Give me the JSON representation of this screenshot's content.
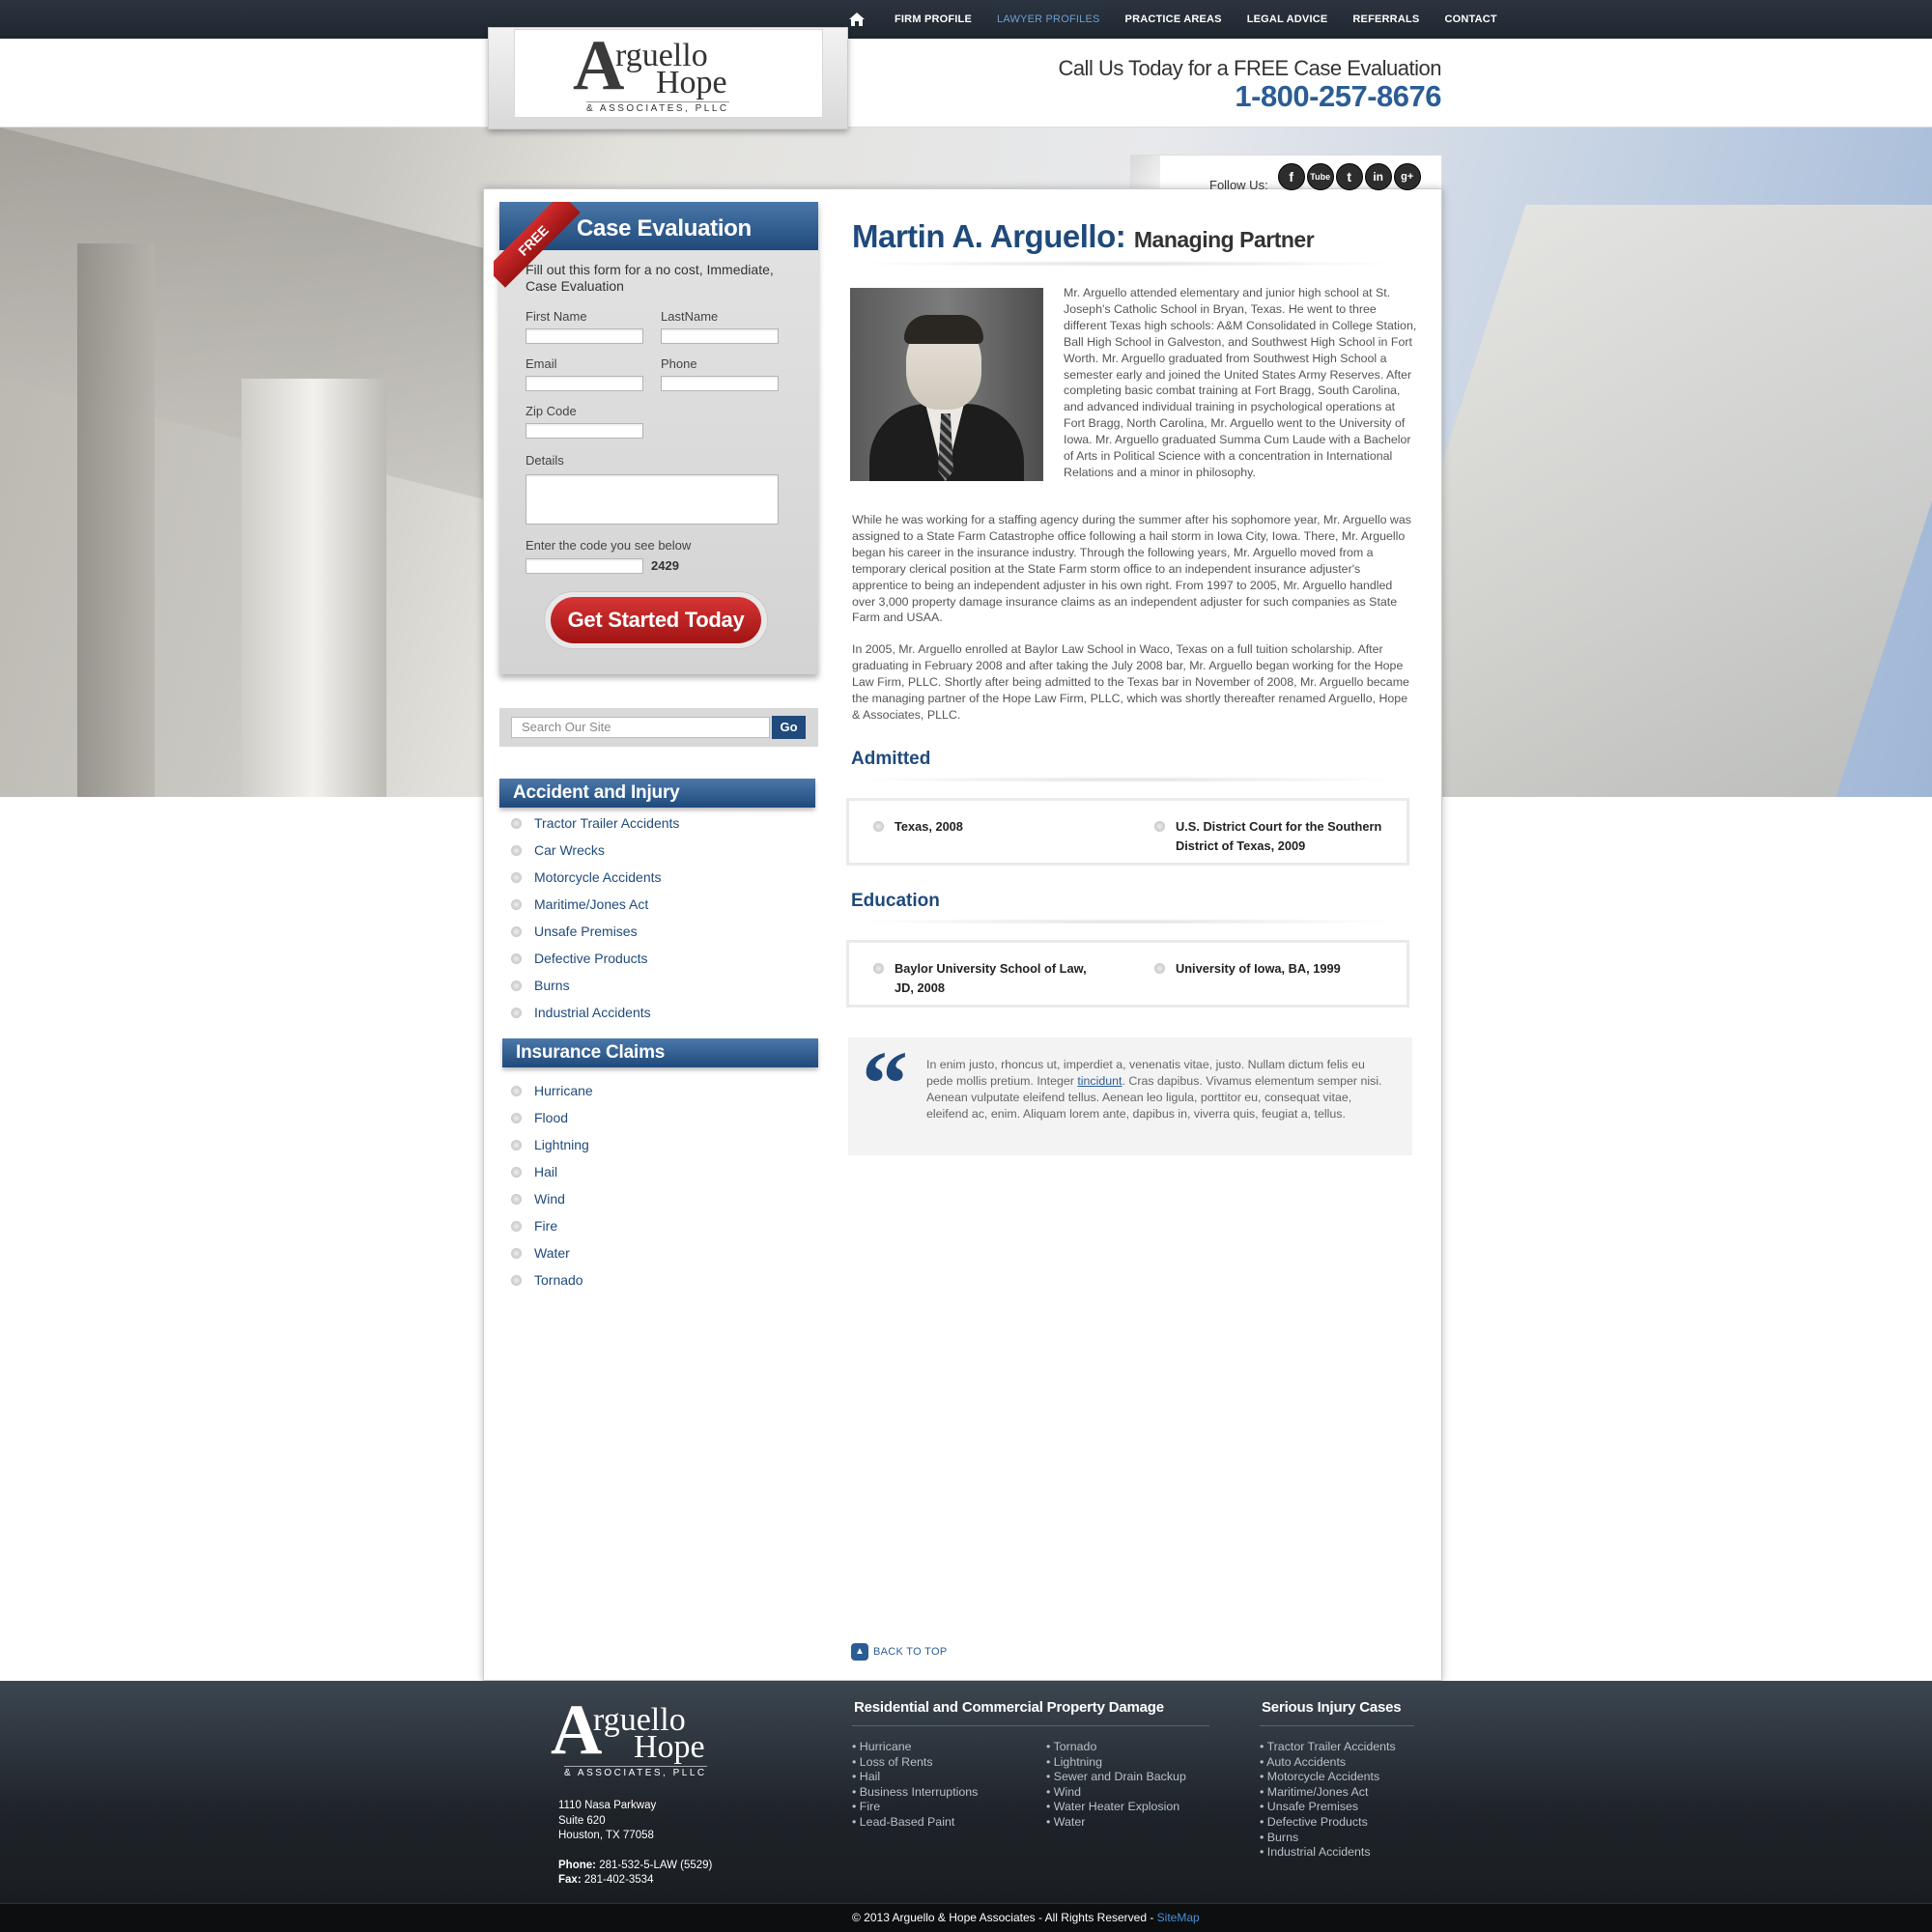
{
  "nav": {
    "items": [
      "FIRM PROFILE",
      "LAWYER PROFILES",
      "PRACTICE AREAS",
      "LEGAL ADVICE",
      "REFERRALS",
      "CONTACT"
    ]
  },
  "brand": {
    "letter": "A",
    "word1": "rguello",
    "word2": "Hope",
    "tagline": "& ASSOCIATES, PLLC"
  },
  "header": {
    "call_text": "Call Us Today for a FREE Case Evaluation",
    "phone": "1-800-257-8676"
  },
  "social": {
    "label": "Follow Us:",
    "icons": [
      "f",
      "Tube",
      "t",
      "in",
      "g+"
    ]
  },
  "case_eval": {
    "ribbon": "FREE",
    "title": "Case Evaluation",
    "intro": "Fill out this form for a no cost, Immediate, Case Evaluation",
    "first_name": "First Name",
    "last_name": "LastName",
    "email": "Email",
    "phone": "Phone",
    "zip": "Zip Code",
    "details": "Details",
    "code_label": "Enter the code you see below",
    "code": "2429",
    "submit": "Get Started Today"
  },
  "search": {
    "placeholder": "Search Our Site",
    "go": "Go"
  },
  "accident": {
    "title": "Accident and Injury",
    "items": [
      "Tractor Trailer Accidents",
      "Car Wrecks",
      "Motorcycle Accidents",
      "Maritime/Jones Act",
      "Unsafe Premises",
      "Defective Products",
      "Burns",
      "Industrial Accidents"
    ]
  },
  "insurance": {
    "title": "Insurance Claims",
    "items": [
      "Hurricane",
      "Flood",
      "Lightning",
      "Hail",
      "Wind",
      "Fire",
      "Water",
      "Tornado"
    ]
  },
  "profile": {
    "name": "Martin A. Arguello:",
    "role": "Managing Partner",
    "bio1": "Mr. Arguello attended elementary and junior high school at St. Joseph's Catholic School in Bryan, Texas. He went to three different Texas high schools: A&M Consolidated in College Station, Ball High School in Galveston, and Southwest High School in Fort Worth. Mr. Arguello graduated from Southwest High School a semester early and joined the United States Army Reserves. After completing basic combat training at Fort Bragg, South Carolina, and advanced individual training in psychological operations at Fort Bragg, North Carolina, Mr. Arguello went to the University of Iowa. Mr. Arguello graduated Summa Cum Laude with a Bachelor of Arts in Political Science with a concentration in International Relations and a minor in philosophy.",
    "bio2": "While he was working for a staffing agency during the summer after his sophomore year, Mr. Arguello was assigned to a State Farm Catastrophe office following a hail storm in Iowa City, Iowa. There, Mr. Arguello began his career in the insurance industry. Through the following years, Mr. Arguello moved from a temporary clerical position at the State Farm storm office to an independent insurance adjuster's apprentice to being an independent adjuster in his own right. From 1997 to 2005, Mr. Arguello handled over 3,000 property damage insurance claims as an independent adjuster for such companies as State Farm and USAA.",
    "bio3": "In 2005, Mr. Arguello enrolled at Baylor Law School in Waco, Texas on a full tuition scholarship. After graduating in February 2008 and after taking the July 2008 bar, Mr. Arguello began working for the Hope Law Firm, PLLC. Shortly after being admitted to the Texas bar in November of 2008, Mr. Arguello became the managing partner of the Hope Law Firm, PLLC, which was shortly thereafter renamed Arguello, Hope & Associates, PLLC.",
    "admitted_title": "Admitted",
    "admitted": [
      "Texas, 2008",
      "U.S. District Court for the Southern District of Texas, 2009"
    ],
    "education_title": "Education",
    "education": [
      "Baylor University School of Law, JD, 2008",
      "University of Iowa, BA, 1999"
    ],
    "quote_before": "In enim justo, rhoncus ut, imperdiet a, venenatis vitae, justo. Nullam dictum felis eu pede mollis pretium. Integer ",
    "quote_link": "tincidunt",
    "quote_after": ". Cras dapibus. Vivamus elementum semper nisi. Aenean vulputate eleifend tellus. Aenean leo ligula, porttitor eu, consequat vitae, eleifend ac, enim. Aliquam lorem ante, dapibus in, viverra quis, feugiat a, tellus.",
    "back_to_top": "BACK TO TOP"
  },
  "footer": {
    "address": [
      "1110 Nasa Parkway",
      "Suite 620",
      "Houston, TX 77058"
    ],
    "phone_label": "Phone:",
    "phone": "281-532-5-LAW (5529)",
    "fax_label": "Fax:",
    "fax": "281-402-3534",
    "residential_title": "Residential and Commercial Property Damage",
    "residential_col1": [
      "Hurricane",
      "Loss of Rents",
      "Hail",
      "Business Interruptions",
      "Fire",
      "Lead-Based Paint"
    ],
    "residential_col2": [
      "Tornado",
      "Lightning",
      "Sewer and Drain Backup",
      "Wind",
      "Water Heater Explosion",
      "Water"
    ],
    "serious_title": "Serious Injury Cases",
    "serious": [
      "Tractor Trailer Accidents",
      "Auto Accidents",
      "Motorcycle Accidents",
      "Maritime/Jones Act",
      "Unsafe Premises",
      "Defective Products",
      "Burns",
      "Industrial Accidents"
    ],
    "copyright": "© 2013 Arguello & Hope Associates - All Rights Reserved - ",
    "sitemap": "SiteMap"
  }
}
